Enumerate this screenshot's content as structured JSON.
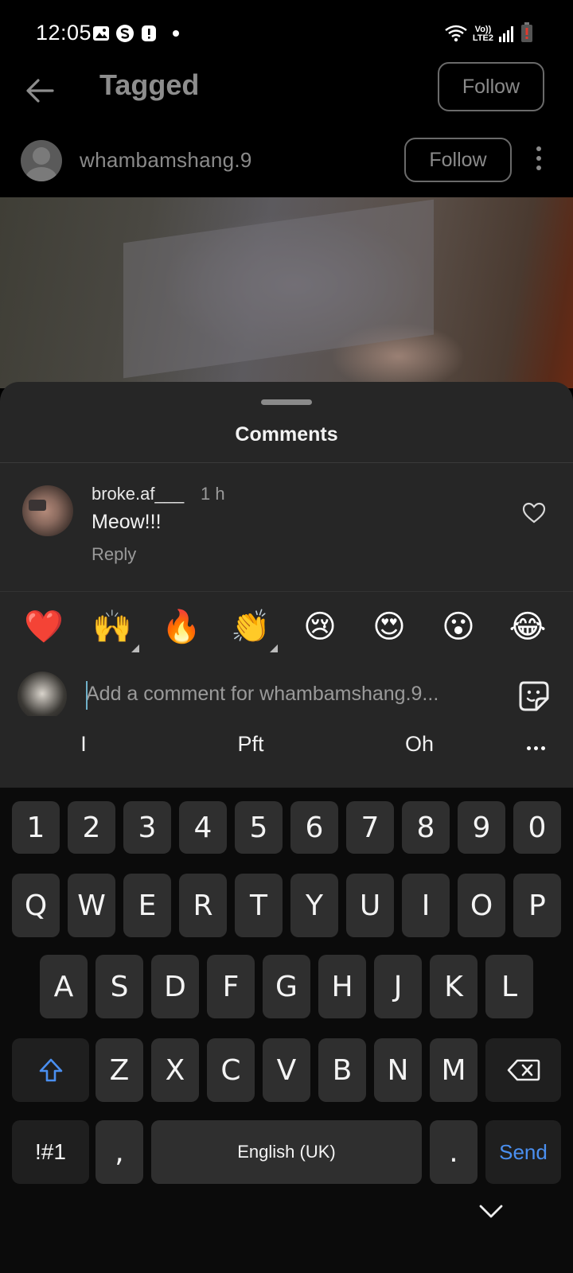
{
  "status_bar": {
    "time": "12:05",
    "icons": [
      "gallery-icon",
      "s-app-icon",
      "alert-icon",
      "notification-dot"
    ],
    "right_icons": [
      "wifi-icon",
      "volte-lte2-icon",
      "signal-icon",
      "battery-low-icon"
    ],
    "volte_label": "Vo))",
    "lte_label": "LTE2"
  },
  "header": {
    "title": "Tagged",
    "follow_label": "Follow"
  },
  "post": {
    "author": "whambamshang.9",
    "follow_label": "Follow"
  },
  "comments_sheet": {
    "title": "Comments",
    "comments": [
      {
        "user": "broke.af___",
        "time": "1 h",
        "text": "Meow!!!",
        "reply_label": "Reply"
      }
    ],
    "quick_emojis": [
      "❤️",
      "🙌",
      "🔥",
      "👏",
      "😢",
      "😍",
      "😮",
      "😂"
    ],
    "input_placeholder": "Add a comment for whambamshang.9..."
  },
  "keyboard": {
    "suggestions": [
      "I",
      "Pft",
      "Oh"
    ],
    "number_row": [
      "1",
      "2",
      "3",
      "4",
      "5",
      "6",
      "7",
      "8",
      "9",
      "0"
    ],
    "row1": [
      "Q",
      "W",
      "E",
      "R",
      "T",
      "Y",
      "U",
      "I",
      "O",
      "P"
    ],
    "row2": [
      "A",
      "S",
      "D",
      "F",
      "G",
      "H",
      "J",
      "K",
      "L"
    ],
    "row3": [
      "Z",
      "X",
      "C",
      "V",
      "B",
      "N",
      "M"
    ],
    "symbols_label": "!#1",
    "comma_label": ",",
    "space_label": "English (UK)",
    "period_label": ".",
    "send_label": "Send",
    "accent_color": "#4a8ff0"
  }
}
